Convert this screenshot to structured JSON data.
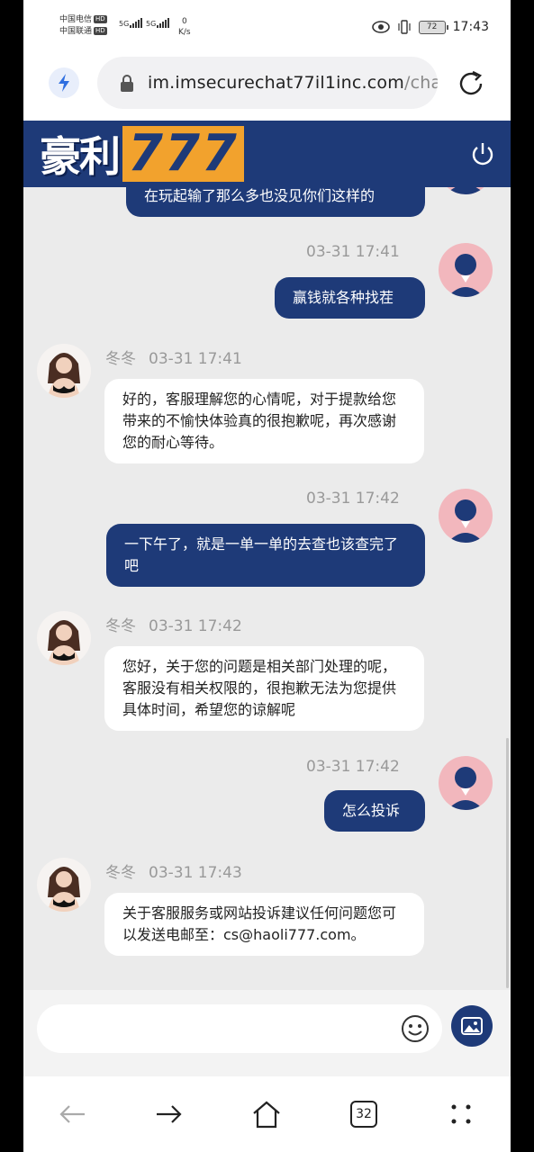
{
  "status_bar": {
    "carrier1": "中国电信",
    "carrier2": "中国联通",
    "hd": "HD",
    "net1": "5G",
    "net2": "5G",
    "speed_value": "0",
    "speed_unit": "K/s",
    "battery": "72",
    "time": "17:43"
  },
  "browser": {
    "url_host": "im.imsecurechat77il1inc.com",
    "url_path": "/chat",
    "tab_count": "32"
  },
  "app": {
    "logo_text": "豪利",
    "logo_number": "777",
    "colors": {
      "primary": "#1e3a78",
      "accent": "#f2a22d"
    }
  },
  "messages": [
    {
      "direction": "out",
      "text": "在玩起输了那么多也没见你们这样的"
    },
    {
      "direction": "out",
      "time": "03-31 17:41",
      "text": "赢钱就各种找茬"
    },
    {
      "direction": "in",
      "sender": "冬冬",
      "time": "03-31 17:41",
      "text": "好的，客服理解您的心情呢，对于提款给您带来的不愉快体验真的很抱歉呢，再次感谢您的耐心等待。"
    },
    {
      "direction": "out",
      "time": "03-31 17:42",
      "text": "一下午了，就是一单一单的去查也该查完了吧"
    },
    {
      "direction": "in",
      "sender": "冬冬",
      "time": "03-31 17:42",
      "text": "您好，关于您的问题是相关部门处理的呢，客服没有相关权限的，很抱歉无法为您提供具体时间，希望您的谅解呢"
    },
    {
      "direction": "out",
      "time": "03-31 17:42",
      "text": "怎么投诉"
    },
    {
      "direction": "in",
      "sender": "冬冬",
      "time": "03-31 17:43",
      "text": "关于客服服务或网站投诉建议任何问题您可以发送电邮至：cs@haoli777.com。"
    }
  ],
  "composer": {
    "placeholder": ""
  },
  "icons": [
    "bolt-icon",
    "lock-icon",
    "reload-icon",
    "power-icon",
    "emoji-icon",
    "image-icon",
    "back-icon",
    "forward-icon",
    "home-icon",
    "menu-icon",
    "eye-icon",
    "vibrate-icon"
  ]
}
